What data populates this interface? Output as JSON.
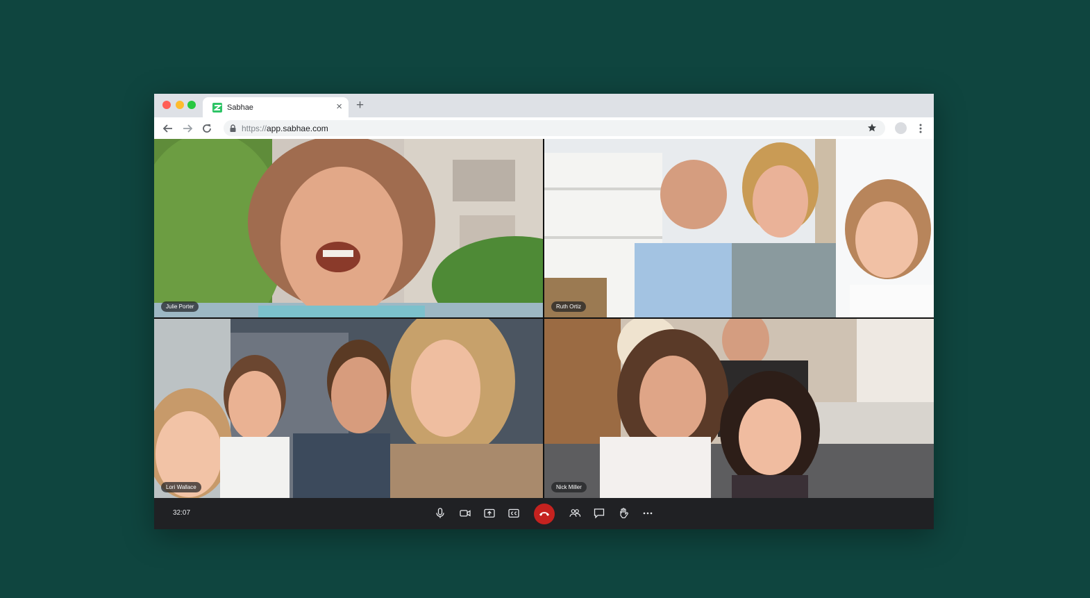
{
  "browser": {
    "tab_title": "Sabhae",
    "tab_close": "×",
    "new_tab": "+",
    "url_scheme": "https://",
    "url_host": "app.sabhae.com"
  },
  "meeting": {
    "participants": [
      {
        "name": "Julie Porter"
      },
      {
        "name": "Ruth Ortiz"
      },
      {
        "name": "Lori Wallace"
      },
      {
        "name": "Nick Miller"
      }
    ],
    "elapsed_time": "32:07"
  },
  "controls": {
    "icons": [
      "microphone-icon",
      "camera-icon",
      "share-screen-icon",
      "captions-icon",
      "hang-up-icon",
      "participants-icon",
      "chat-icon",
      "raise-hand-icon",
      "more-options-icon"
    ]
  },
  "colors": {
    "background": "#0f453f",
    "brand": "#2ec466",
    "hang_up": "#c5221f",
    "control_bar": "#202124"
  }
}
